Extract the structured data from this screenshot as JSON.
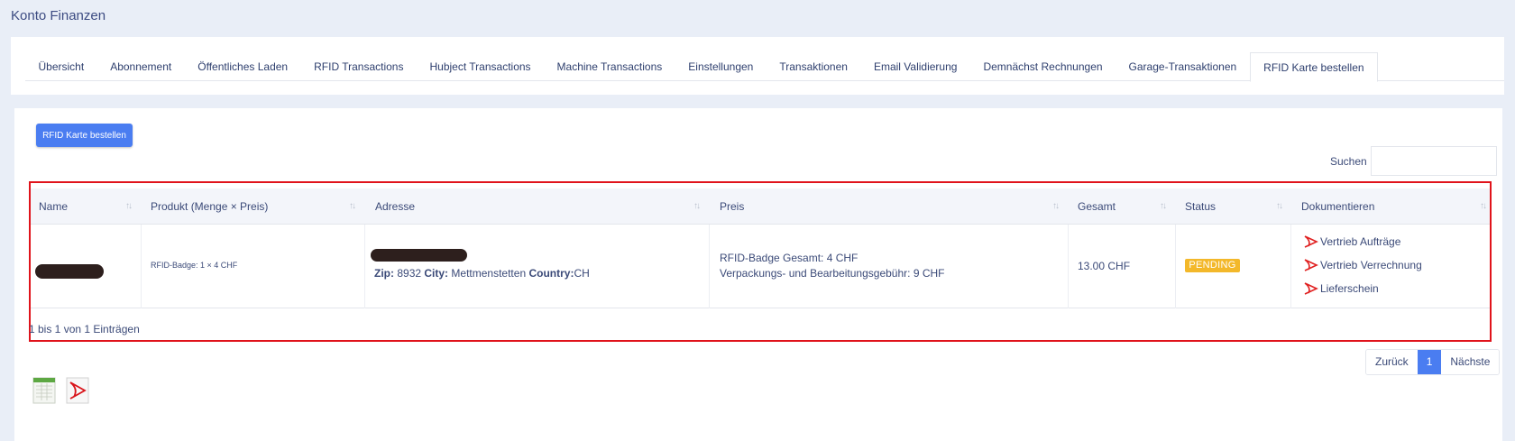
{
  "page": {
    "title": "Konto Finanzen"
  },
  "tabs": [
    {
      "label": "Übersicht"
    },
    {
      "label": "Abonnement"
    },
    {
      "label": "Öffentliches Laden"
    },
    {
      "label": "RFID Transactions"
    },
    {
      "label": "Hubject Transactions"
    },
    {
      "label": "Machine Transactions"
    },
    {
      "label": "Einstellungen"
    },
    {
      "label": "Transaktionen"
    },
    {
      "label": "Email Validierung"
    },
    {
      "label": "Demnächst Rechnungen"
    },
    {
      "label": "Garage-Transaktionen"
    },
    {
      "label": "RFID Karte bestellen",
      "active": true
    }
  ],
  "toolbar": {
    "order_button": "RFID Karte bestellen"
  },
  "search": {
    "label": "Suchen",
    "value": "",
    "placeholder": ""
  },
  "table": {
    "columns": [
      "Name",
      "Produkt (Menge × Preis)",
      "Adresse",
      "Preis",
      "Gesamt",
      "Status",
      "Dokumentieren"
    ],
    "rows": [
      {
        "product": "RFID-Badge: 1 × 4 CHF",
        "zip_label": "Zip:",
        "zip": "8932",
        "city_label": "City:",
        "city": "Mettmenstetten",
        "country_label": "Country:",
        "country": "CH",
        "price_line1": "RFID-Badge Gesamt: 4 CHF",
        "price_line2": "Verpackungs- und Bearbeitungsgebühr: 9 CHF",
        "total": "13.00 CHF",
        "status": "PENDING",
        "documents": [
          "Vertrieb Aufträge",
          "Vertrieb Verrechnung",
          "Lieferschein"
        ]
      }
    ]
  },
  "info": "1 bis 1 von 1 Einträgen",
  "pagination": {
    "prev": "Zurück",
    "current": "1",
    "next": "Nächste"
  },
  "colors": {
    "accent": "#4a7df1",
    "pending": "#f3b82a",
    "highlight": "#e0131b"
  },
  "icons": {
    "document": "pdf-icon",
    "export_excel": "excel-icon",
    "export_pdf": "pdf-icon"
  }
}
